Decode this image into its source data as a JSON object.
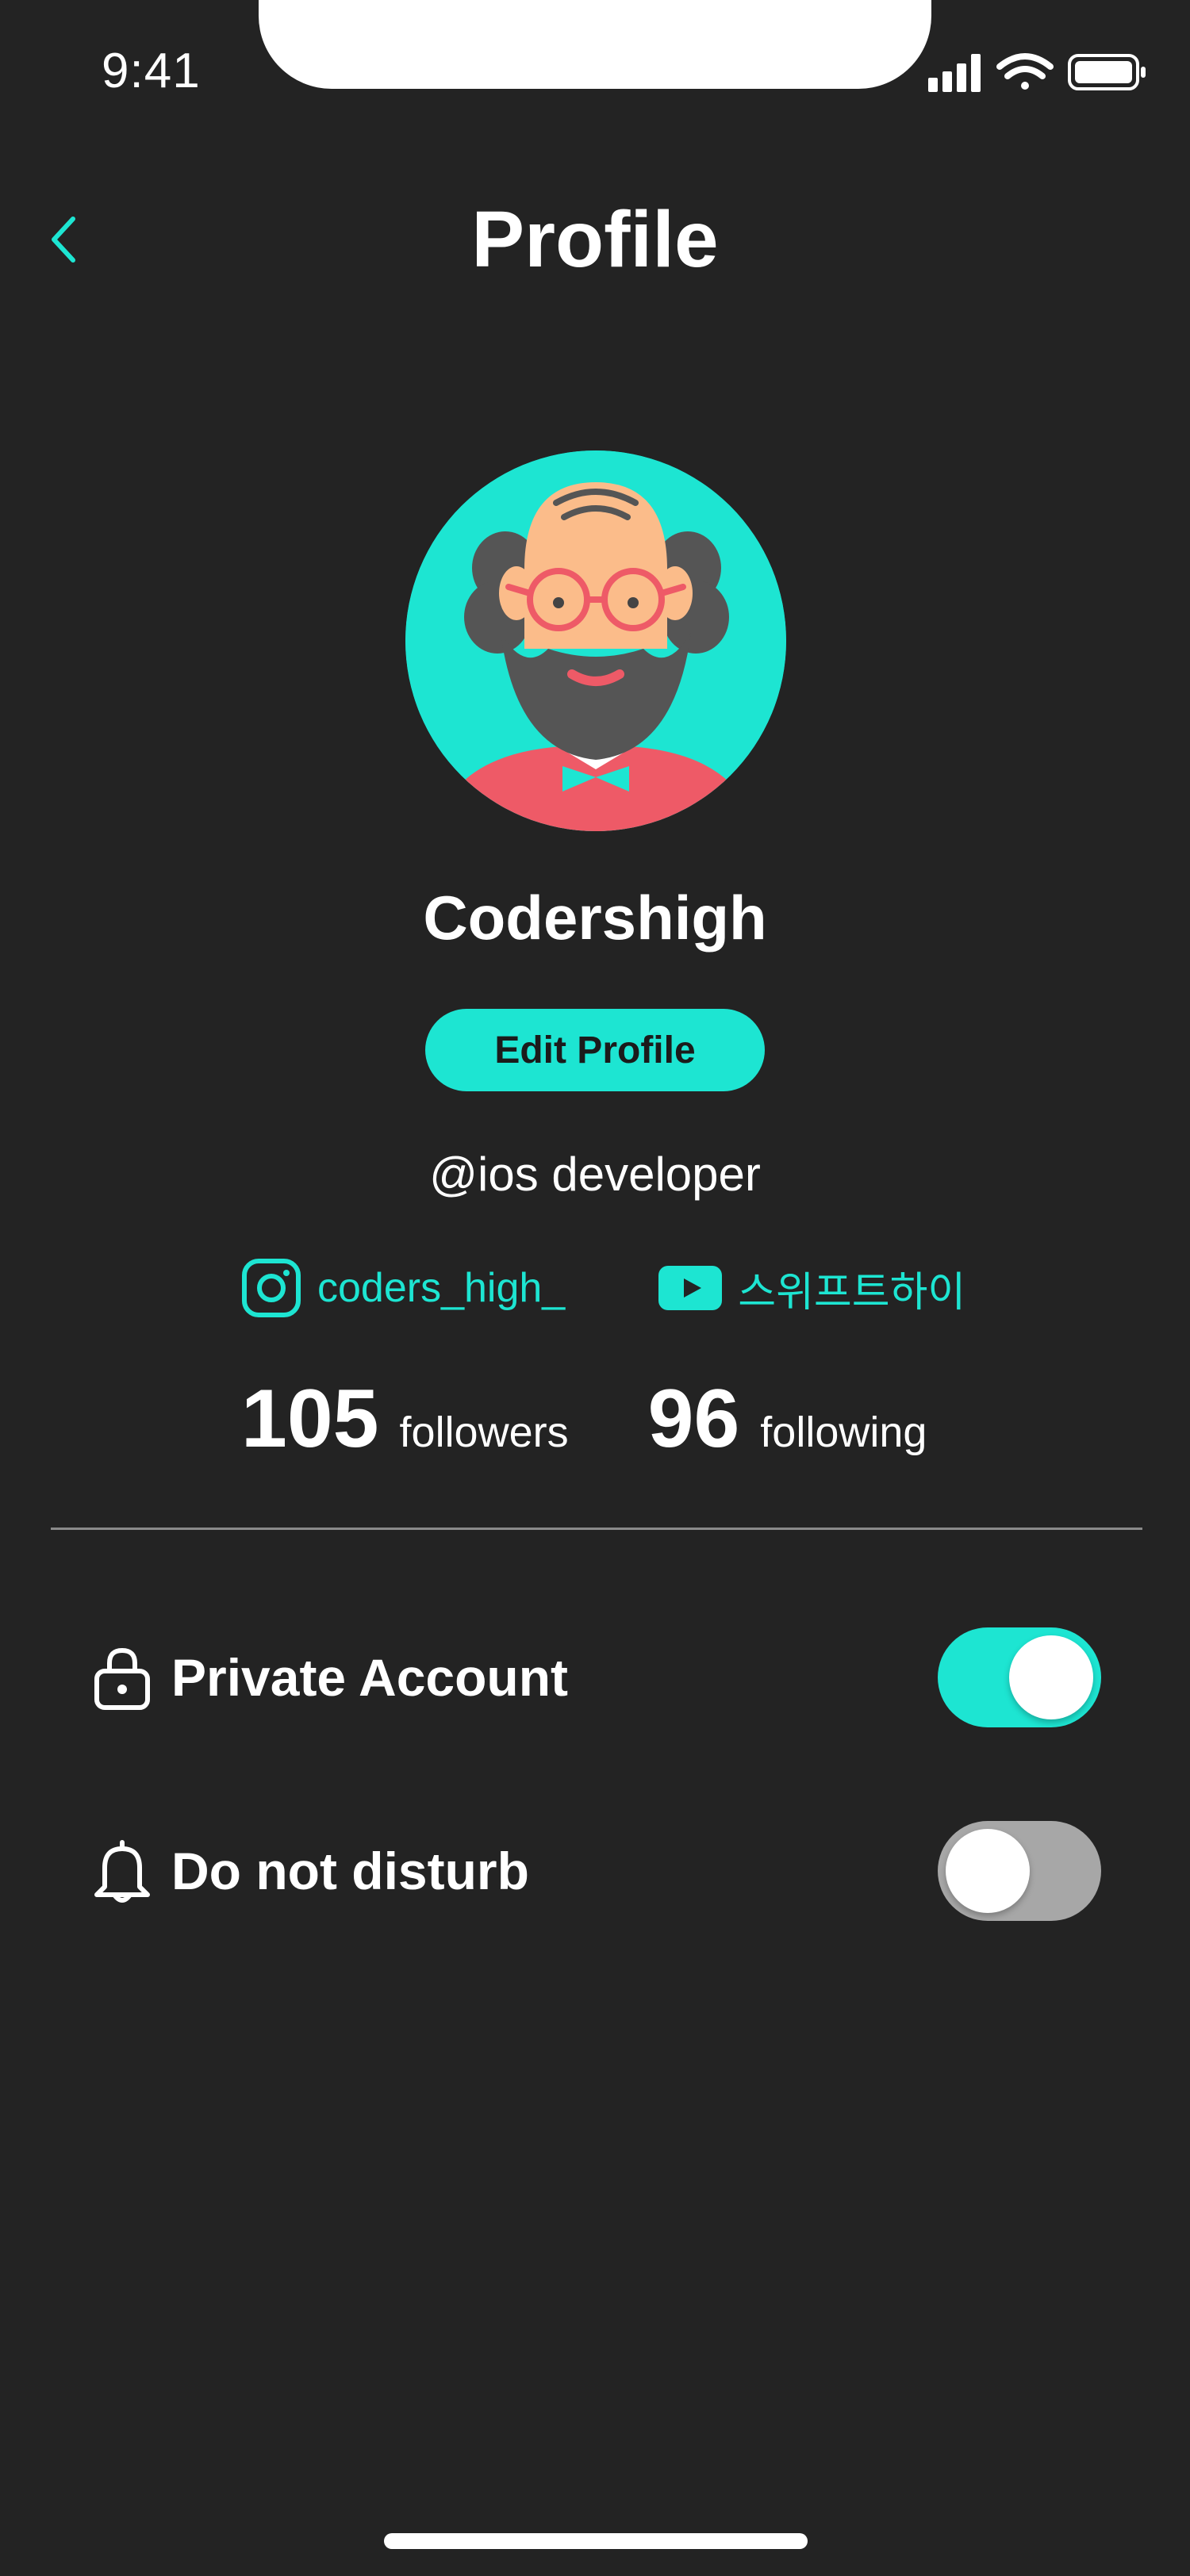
{
  "status_bar": {
    "time": "9:41"
  },
  "header": {
    "title": "Profile"
  },
  "profile": {
    "username": "Codershigh",
    "edit_label": "Edit Profile",
    "bio": "@ios developer",
    "instagram": "coders_high_",
    "youtube": "스위프트하이",
    "followers_count": "105",
    "followers_label": "followers",
    "following_count": "96",
    "following_label": "following"
  },
  "settings": [
    {
      "label": "Private Account",
      "icon": "lock-icon",
      "enabled": true
    },
    {
      "label": "Do not disturb",
      "icon": "bell-icon",
      "enabled": false
    }
  ],
  "colors": {
    "accent": "#1de5d2",
    "background": "#232323",
    "toggle_off": "#a7a7a7"
  }
}
